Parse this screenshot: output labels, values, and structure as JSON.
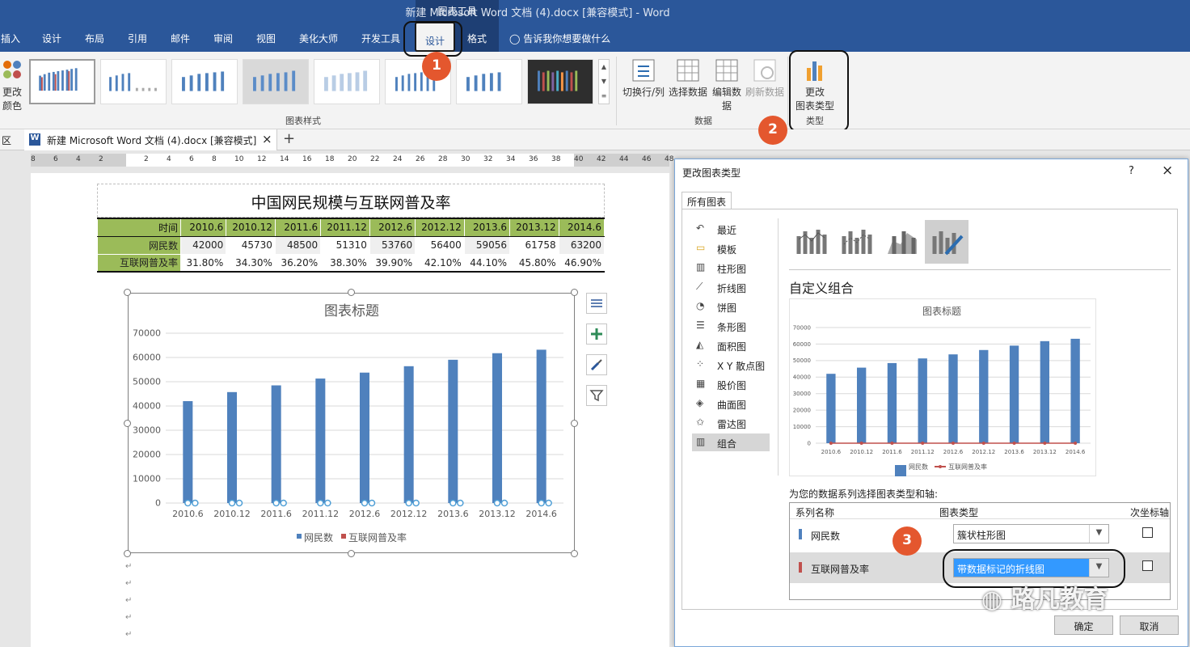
{
  "window": {
    "title": "新建 Microsoft Word 文档 (4).docx [兼容模式] - Word",
    "context_group": "图表工具",
    "tell_me": "告诉我你想要做什么"
  },
  "tabs": [
    "插入",
    "设计",
    "布局",
    "引用",
    "邮件",
    "审阅",
    "视图",
    "美化大师",
    "开发工具",
    "设计",
    "格式"
  ],
  "ribbon": {
    "change_colors": [
      "更改",
      "颜色"
    ],
    "chart_styles_label": "图表样式",
    "data_label": "数据",
    "type_label": "类型",
    "switch_row_col": "切换行/列",
    "select_data": "选择数据",
    "edit_data": [
      "编辑数",
      "据"
    ],
    "refresh_data": "刷新数据",
    "change_chart_type": [
      "更改",
      "图表类型"
    ]
  },
  "doc_tab": {
    "left_stub": "区",
    "name": "新建 Microsoft Word 文档 (4).docx [兼容模式]",
    "close": "×",
    "add": "+"
  },
  "ruler": [
    "8",
    "6",
    "4",
    "2",
    "2",
    "4",
    "6",
    "8",
    "10",
    "12",
    "14",
    "16",
    "18",
    "20",
    "22",
    "24",
    "26",
    "28",
    "30",
    "32",
    "34",
    "36",
    "38",
    "40",
    "42",
    "44",
    "46",
    "48"
  ],
  "document": {
    "table_title": "中国网民规模与互联网普及率",
    "table": {
      "headers": [
        "时间",
        "2010.6",
        "2010.12",
        "2011.6",
        "2011.12",
        "2012.6",
        "2012.12",
        "2013.6",
        "2013.12",
        "2014.6"
      ],
      "rows": [
        [
          "网民数",
          "42000",
          "45730",
          "48500",
          "51310",
          "53760",
          "56400",
          "59056",
          "61758",
          "63200"
        ],
        [
          "互联网普及率",
          "31.80%",
          "34.30%",
          "36.20%",
          "38.30%",
          "39.90%",
          "42.10%",
          "44.10%",
          "45.80%",
          "46.90%"
        ]
      ]
    }
  },
  "chart_data": [
    {
      "type": "bar",
      "title": "图表标题",
      "categories": [
        "2010.6",
        "2010.12",
        "2011.6",
        "2011.12",
        "2012.6",
        "2012.12",
        "2013.6",
        "2013.12",
        "2014.6"
      ],
      "series": [
        {
          "name": "网民数",
          "values": [
            42000,
            45730,
            48500,
            51310,
            53760,
            56400,
            59056,
            61758,
            63200
          ],
          "color": "#4f81bd"
        },
        {
          "name": "互联网普及率",
          "values": [
            0.318,
            0.343,
            0.362,
            0.383,
            0.399,
            0.421,
            0.441,
            0.458,
            0.469
          ],
          "color": "#c0504d"
        }
      ],
      "ylim": [
        0,
        70000
      ],
      "yticks": [
        "70000",
        "60000",
        "50000",
        "40000",
        "30000",
        "20000",
        "10000",
        "0"
      ],
      "grid": true,
      "legend": "bottom"
    },
    {
      "type": "bar",
      "title": "图表标题",
      "categories": [
        "2010.6",
        "2010.12",
        "2011.6",
        "2011.12",
        "2012.6",
        "2012.12",
        "2013.6",
        "2013.12",
        "2014.6"
      ],
      "series": [
        {
          "name": "网民数",
          "values": [
            42000,
            45730,
            48500,
            51310,
            53760,
            56400,
            59056,
            61758,
            63200
          ],
          "color": "#4f81bd"
        },
        {
          "name": "互联网普及率",
          "values": [
            0.318,
            0.343,
            0.362,
            0.383,
            0.399,
            0.421,
            0.441,
            0.458,
            0.469
          ],
          "color": "#c0504d"
        }
      ],
      "ylim": [
        0,
        70000
      ],
      "yticks": [
        "70000",
        "60000",
        "50000",
        "40000",
        "30000",
        "20000",
        "10000",
        "0"
      ],
      "grid": true,
      "legend": "bottom"
    }
  ],
  "dialog": {
    "title": "更改图表类型",
    "help": "?",
    "close": "×",
    "tab": "所有图表",
    "categories": [
      "最近",
      "模板",
      "柱形图",
      "折线图",
      "饼图",
      "条形图",
      "面积图",
      "X Y 散点图",
      "股价图",
      "曲面图",
      "雷达图",
      "组合"
    ],
    "selected_category": "组合",
    "subtype_title": "自定义组合",
    "series_prompt": "为您的数据系列选择图表类型和轴:",
    "col_series": "系列名称",
    "col_type": "图表类型",
    "col_axis": "次坐标轴",
    "series_rows": [
      {
        "name": "网民数",
        "type": "簇状柱形图",
        "color": "#4f81bd"
      },
      {
        "name": "互联网普及率",
        "type": "带数据标记的折线图",
        "color": "#c0504d"
      }
    ],
    "ok": "确定",
    "cancel": "取消"
  },
  "annotations": [
    "1",
    "2",
    "3"
  ],
  "watermark": "路凡教育"
}
